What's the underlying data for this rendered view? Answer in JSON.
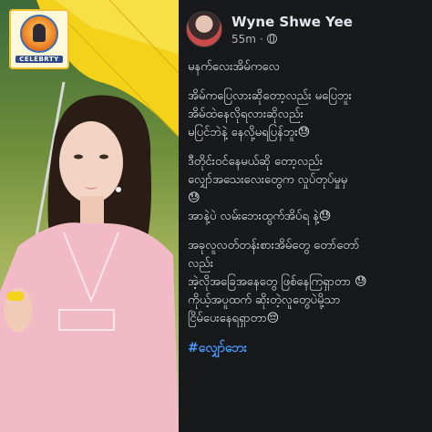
{
  "photo": {
    "badge_text": "CELEBRTY"
  },
  "post": {
    "author": "Wyne Shwe Yee",
    "time": "55m",
    "separator": "·",
    "lines": {
      "p1": [
        "မနက်လေးအိမ်ကလေ"
      ],
      "p2": [
        "အိမ်ကပြေလားဆိုတော့လည်း မပြေဘူး",
        "အိမ်ထဲနေလိုရလားဆိုလည်း",
        "မပြင်ဘဲနဲ့ နေလို့မရပြန်ဘူး😓"
      ],
      "p3": [
        "ဒီတိုင်းဝင်နေမယ်ဆို တော့လည်း",
        "လျှော်အသေးလေးတွေက လှုပ်တုပ်မှုမှ",
        "😓",
        "အာနဲ့ပဲ လမ်းဘေးထွက်အိပ်ရ နဲ့😓"
      ],
      "p4": [
        "အခုလူလတ်တန်းစားအိမ်တွေ တော်တော်",
        "လည်း",
        "အဲ့လိုအခြေအနေတွေ ဖြစ်နေကြရှာတာ 😓",
        "ကိုယ့်အပူထက် ဆိုးတဲ့လူတွေပဲမို့သာ",
        "ငြိမ်ပေးနေရရှာတာ😔"
      ]
    },
    "hashtag": "#လျှော်ဘေး"
  }
}
